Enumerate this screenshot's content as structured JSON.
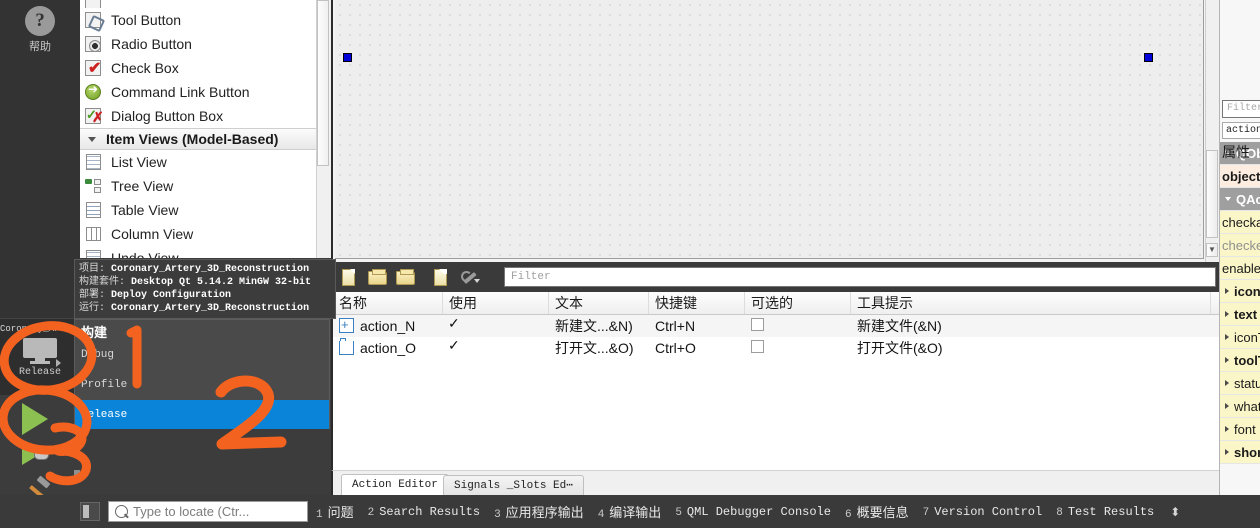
{
  "modebar": {
    "help_icon": "question-mark-icon",
    "help_label": "帮助",
    "project_name": "Coronary_Artery...",
    "build_config": "Release",
    "run_icon": "run-triangle-icon",
    "debug_icon": "debug-triangle-bug-icon",
    "build_icon": "hammer-icon"
  },
  "widget_box": {
    "items": [
      {
        "label": "Tool Button",
        "icon": "tool-button-icon",
        "type": "item"
      },
      {
        "label": "Radio Button",
        "icon": "radio-button-icon",
        "type": "item"
      },
      {
        "label": "Check Box",
        "icon": "check-box-icon",
        "type": "item"
      },
      {
        "label": "Command Link Button",
        "icon": "command-link-button-icon",
        "type": "item"
      },
      {
        "label": "Dialog Button Box",
        "icon": "dialog-button-box-icon",
        "type": "item"
      },
      {
        "label": "Item Views (Model-Based)",
        "icon": "collapse-arrow-icon",
        "type": "category"
      },
      {
        "label": "List View",
        "icon": "list-view-icon",
        "type": "item"
      },
      {
        "label": "Tree View",
        "icon": "tree-view-icon",
        "type": "item"
      },
      {
        "label": "Table View",
        "icon": "table-view-icon",
        "type": "item"
      },
      {
        "label": "Column View",
        "icon": "column-view-icon",
        "type": "item"
      },
      {
        "label": "Undo View",
        "icon": "undo-view-icon",
        "type": "item"
      }
    ]
  },
  "tooltip": {
    "lines": [
      {
        "label": "项目:",
        "value": "Coronary_Artery_3D_Reconstruction"
      },
      {
        "label": "构建套件:",
        "value": "Desktop Qt 5.14.2 MinGW 32-bit"
      },
      {
        "label": "部署:",
        "value": "Deploy Configuration"
      },
      {
        "label": "运行:",
        "value": "Coronary_Artery_3D_Reconstruction"
      }
    ]
  },
  "context_menu": {
    "title": "构建",
    "items": [
      {
        "label": "Debug",
        "selected": false
      },
      {
        "label": "Profile",
        "selected": false
      },
      {
        "label": "Release",
        "selected": true
      }
    ]
  },
  "action_editor": {
    "toolbar": [
      {
        "icon": "new-action-icon",
        "name": "new-action"
      },
      {
        "icon": "copy-action-icon",
        "name": "copy-action"
      },
      {
        "icon": "paste-action-icon",
        "name": "paste-action"
      },
      {
        "icon": "delete-action-icon",
        "name": "delete-action"
      },
      {
        "icon": "configure-wrench-icon",
        "name": "configure-view"
      }
    ],
    "filter_placeholder": "Filter",
    "columns": [
      "名称",
      "使用",
      "文本",
      "快捷键",
      "可选的",
      "工具提示"
    ],
    "rows": [
      {
        "icon": "new-file-action-icon",
        "name": "action_N",
        "used": true,
        "text": "新建文...&N)",
        "shortcut": "Ctrl+N",
        "checkable": false,
        "tooltip": "新建文件(&N)"
      },
      {
        "icon": "open-file-action-icon",
        "name": "action_O",
        "used": true,
        "text": "打开文...&O)",
        "shortcut": "Ctrl+O",
        "checkable": false,
        "tooltip": "打开文件(&O)"
      }
    ],
    "tabs": [
      {
        "label": "Action Editor",
        "active": true
      },
      {
        "label": "Signals _Slots Ed⋯",
        "active": false
      }
    ]
  },
  "property_editor": {
    "filter_placeholder": "Filter",
    "object_name": "action",
    "header": "属性",
    "rows": [
      {
        "label": "QObject",
        "kind": "group",
        "expander": "down"
      },
      {
        "label": "objectName",
        "kind": "highlight",
        "expander": "none"
      },
      {
        "label": "QAction",
        "kind": "group",
        "expander": "down"
      },
      {
        "label": "checkable",
        "kind": "yellow",
        "expander": "none"
      },
      {
        "label": "checked",
        "kind": "yellow-dim",
        "expander": "none"
      },
      {
        "label": "enabled",
        "kind": "yellow",
        "expander": "none"
      },
      {
        "label": "icon",
        "kind": "yellow-bold",
        "expander": "right"
      },
      {
        "label": "text",
        "kind": "yellow-bold",
        "expander": "right"
      },
      {
        "label": "iconText",
        "kind": "yellow",
        "expander": "right"
      },
      {
        "label": "toolTip",
        "kind": "yellow-bold",
        "expander": "right"
      },
      {
        "label": "statusTip",
        "kind": "yellow",
        "expander": "right"
      },
      {
        "label": "whatsThis",
        "kind": "yellow",
        "expander": "right"
      },
      {
        "label": "font",
        "kind": "yellow",
        "expander": "right"
      },
      {
        "label": "shortcut",
        "kind": "yellow-bold",
        "expander": "right"
      }
    ]
  },
  "status_bar": {
    "search_placeholder": "Type to locate (Ctr...",
    "search_icon": "magnifier-icon",
    "sidebar_toggle_icon": "panel-toggle-icon",
    "items": [
      {
        "num": "1",
        "label": "问题",
        "cjk": true
      },
      {
        "num": "2",
        "label": "Search Results",
        "cjk": false
      },
      {
        "num": "3",
        "label": "应用程序输出",
        "cjk": true
      },
      {
        "num": "4",
        "label": "编译输出",
        "cjk": true
      },
      {
        "num": "5",
        "label": "QML Debugger Console",
        "cjk": false
      },
      {
        "num": "6",
        "label": "概要信息",
        "cjk": true
      },
      {
        "num": "7",
        "label": "Version Control",
        "cjk": false
      },
      {
        "num": "8",
        "label": "Test Results",
        "cjk": false
      }
    ],
    "updown_icon": "up-down-arrows-icon"
  },
  "annotations": {
    "color": "#f4621f",
    "marks": [
      {
        "label": "1",
        "shape": "circle-and-digit"
      },
      {
        "label": "2",
        "shape": "digit"
      },
      {
        "label": "3",
        "shape": "circle-and-digit"
      }
    ]
  },
  "canvas": {
    "selection_handles": 2,
    "grid": "dotted"
  },
  "colors": {
    "selection_blue": "#0a84d8",
    "handle_blue": "#0000d8",
    "dark_chrome": "#3c3c3c",
    "annotation_orange": "#f4621f"
  }
}
